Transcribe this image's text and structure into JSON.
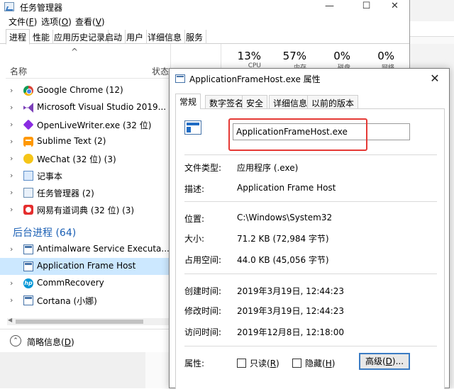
{
  "task_manager": {
    "title": "任务管理器",
    "window_controls": {
      "minimize": "—",
      "maximize": "☐",
      "close": "✕"
    },
    "menu": [
      {
        "label": "文件(",
        "key": "F",
        "tail": ")"
      },
      {
        "label": "选项(",
        "key": "O",
        "tail": ")"
      },
      {
        "label": "查看(",
        "key": "V",
        "tail": ")"
      }
    ],
    "tabs": [
      "进程",
      "性能",
      "应用历史记录",
      "启动",
      "用户",
      "详细信息",
      "服务"
    ],
    "sort_indicator": "^",
    "stats": [
      {
        "value": "13%",
        "label": "CPU"
      },
      {
        "value": "57%",
        "label": "内存"
      },
      {
        "value": "0%",
        "label": "磁盘"
      },
      {
        "value": "0%",
        "label": "网络"
      }
    ],
    "columns": {
      "name": "名称",
      "status": "状态"
    },
    "apps": [
      {
        "name": "Google Chrome (12)",
        "icon": "chrome-icon"
      },
      {
        "name": "Microsoft Visual Studio 2019...",
        "icon": "visual-studio-icon"
      },
      {
        "name": "OpenLiveWriter.exe (32 位)",
        "icon": "open-live-writer-icon"
      },
      {
        "name": "Sublime Text (2)",
        "icon": "sublime-text-icon"
      },
      {
        "name": "WeChat (32 位) (3)",
        "icon": "wechat-icon"
      },
      {
        "name": "记事本",
        "icon": "notepad-icon"
      },
      {
        "name": "任务管理器 (2)",
        "icon": "task-manager-icon"
      },
      {
        "name": "网易有道词典 (32 位) (3)",
        "icon": "youdao-icon"
      }
    ],
    "background_group": "后台进程 (64)",
    "background": [
      {
        "name": "Antimalware Service Executa...",
        "icon": "service-icon",
        "expandable": true
      },
      {
        "name": "Application Frame Host",
        "icon": "service-icon",
        "expandable": false,
        "selected": true
      },
      {
        "name": "CommRecovery",
        "icon": "hp-icon",
        "expandable": true
      },
      {
        "name": "Cortana (小娜)",
        "icon": "cortana-icon",
        "expandable": true
      }
    ],
    "hp_glyph": "hp",
    "footer": {
      "label": "简略信息(",
      "key": "D",
      "tail": ")"
    }
  },
  "dialog": {
    "title": "ApplicationFrameHost.exe 属性",
    "close": "✕",
    "tabs": [
      "常规",
      "数字签名",
      "安全",
      "详细信息",
      "以前的版本"
    ],
    "active_tab": 0,
    "file_name": "ApplicationFrameHost.exe",
    "rows": [
      {
        "label": "文件类型:",
        "value": "应用程序 (.exe)"
      },
      {
        "label": "描述:",
        "value": "Application Frame Host"
      },
      {
        "label": "位置:",
        "value": "C:\\Windows\\System32"
      },
      {
        "label": "大小:",
        "value": "71.2 KB (72,984 字节)"
      },
      {
        "label": "占用空间:",
        "value": "44.0 KB (45,056 字节)"
      },
      {
        "label": "创建时间:",
        "value": "2019年3月19日, 12:44:23"
      },
      {
        "label": "修改时间:",
        "value": "2019年3月19日, 12:44:23"
      },
      {
        "label": "访问时间:",
        "value": "2019年12月8日, 12:18:00"
      }
    ],
    "attributes_label": "属性:",
    "readonly": {
      "label": "只读(",
      "key": "R",
      "tail": ")",
      "checked": false
    },
    "hidden": {
      "label": "隐藏(",
      "key": "H",
      "tail": ")",
      "checked": false
    },
    "advanced_button": {
      "label": "高级(",
      "key": "D",
      "tail": ")..."
    }
  },
  "colors": {
    "selection": "#cce8ff",
    "group_blue": "#1a5fb4",
    "highlight_red": "#e53935"
  }
}
